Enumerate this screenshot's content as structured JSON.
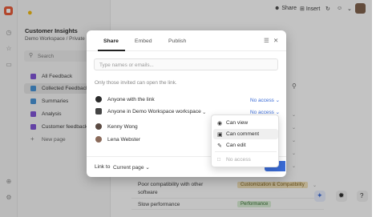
{
  "sidebar": {
    "workspace_title": "Customer Insights",
    "breadcrumb": "Demo Workspace / Private F",
    "search_placeholder": "Search",
    "items": [
      {
        "label": "All Feedback",
        "color": "#7b4bd6"
      },
      {
        "label": "Collected Feedback",
        "color": "#3f8fd6"
      },
      {
        "label": "Summaries",
        "color": "#3f8fd6"
      },
      {
        "label": "Analysis",
        "color": "#7b4bd6"
      },
      {
        "label": "Customer feedback",
        "color": "#7b4bd6"
      },
      {
        "label": "New page",
        "color": "#888888"
      }
    ],
    "new_page_icon": "plus-icon"
  },
  "topbar": {
    "share_label": "Share",
    "insert_label": "Insert"
  },
  "background_table": {
    "rows": [
      {
        "text": "Poor compatibility with other",
        "text2": "software",
        "tag": "Customization & Compatibility",
        "tag_color": "#f3e2b8"
      },
      {
        "text": "Slow performance",
        "tag": "Performance",
        "tag_color": "#d9efd5"
      }
    ]
  },
  "modal": {
    "tabs": [
      "Share",
      "Embed",
      "Publish"
    ],
    "active_tab": "Share",
    "invite_placeholder": "Type names or emails...",
    "hint": "Only those invited can open the link.",
    "permissions": [
      {
        "label": "Anyone with the link",
        "access": "No access",
        "icon": "globe-icon"
      },
      {
        "label": "Anyone in Demo Workspace workspace",
        "access": "No access",
        "icon": "workspace-icon"
      },
      {
        "label": "Kenny Wong",
        "access": "",
        "icon": "avatar"
      },
      {
        "label": "Lena Webster",
        "access": "",
        "icon": "avatar"
      }
    ],
    "footer": {
      "link_to_label": "Link to",
      "link_page_value": "Current page"
    }
  },
  "access_dropdown": {
    "options": [
      {
        "label": "Can view",
        "icon": "eye-icon"
      },
      {
        "label": "Can comment",
        "icon": "comment-icon"
      },
      {
        "label": "Can edit",
        "icon": "pencil-icon"
      },
      {
        "label": "No access",
        "icon": "lock-icon"
      }
    ],
    "highlighted": "Can comment"
  }
}
